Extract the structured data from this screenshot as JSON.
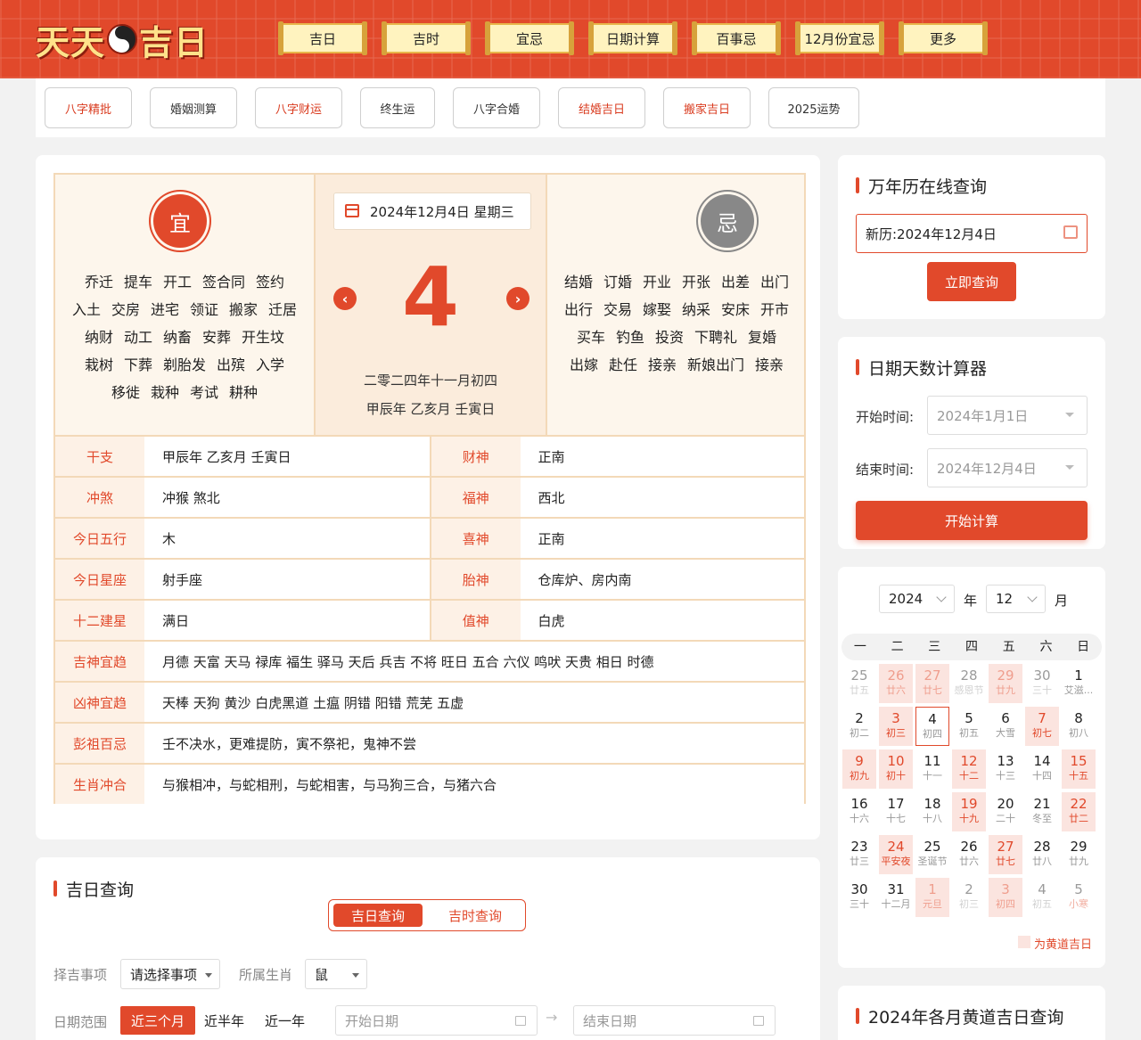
{
  "logo": {
    "part1": "天天",
    "part2": "吉日"
  },
  "nav": [
    "吉日",
    "吉时",
    "宜忌",
    "日期计算",
    "百事忌",
    "12月份宜忌",
    "更多"
  ],
  "tags": [
    {
      "label": "八字精批",
      "red": true
    },
    {
      "label": "婚姻测算",
      "red": false
    },
    {
      "label": "八字财运",
      "red": true
    },
    {
      "label": "终生运",
      "red": false
    },
    {
      "label": "八字合婚",
      "red": false
    },
    {
      "label": "结婚吉日",
      "red": true
    },
    {
      "label": "搬家吉日",
      "red": true
    },
    {
      "label": "2025运势",
      "red": false
    }
  ],
  "almanac": {
    "yi_badge": "宜",
    "ji_badge": "忌",
    "yi": [
      "乔迁",
      "提车",
      "开工",
      "签合同",
      "签约",
      "入土",
      "交房",
      "进宅",
      "领证",
      "搬家",
      "迁居",
      "纳财",
      "动工",
      "纳畜",
      "安葬",
      "开生坟",
      "栽树",
      "下葬",
      "剃胎发",
      "出殡",
      "入学",
      "移徙",
      "栽种",
      "考试",
      "耕种"
    ],
    "ji": [
      "结婚",
      "订婚",
      "开业",
      "开张",
      "出差",
      "出门",
      "出行",
      "交易",
      "嫁娶",
      "纳采",
      "安床",
      "开市",
      "买车",
      "钓鱼",
      "投资",
      "下聘礼",
      "复婚",
      "出嫁",
      "赴任",
      "接亲",
      "新娘出门",
      "接亲"
    ],
    "date_pill": "2024年12月4日 星期三",
    "day_number": "4",
    "prev": "‹",
    "next": "›",
    "lunar_line1": "二零二四年十一月初四",
    "lunar_line2": "甲辰年 乙亥月 壬寅日",
    "pairs": [
      [
        {
          "label": "干支",
          "value": "甲辰年 乙亥月 壬寅日"
        },
        {
          "label": "财神",
          "value": "正南"
        }
      ],
      [
        {
          "label": "冲煞",
          "value": "冲猴 煞北"
        },
        {
          "label": "福神",
          "value": "西北"
        }
      ],
      [
        {
          "label": "今日五行",
          "value": "木"
        },
        {
          "label": "喜神",
          "value": "正南"
        }
      ],
      [
        {
          "label": "今日星座",
          "value": "射手座"
        },
        {
          "label": "胎神",
          "value": "仓库炉、房内南"
        }
      ],
      [
        {
          "label": "十二建星",
          "value": "满日"
        },
        {
          "label": "值神",
          "value": "白虎"
        }
      ]
    ],
    "wide": [
      {
        "label": "吉神宜趋",
        "value": "月德 天富 天马 禄库 福生 驿马 天后 兵吉 不将 旺日 五合 六仪 鸣吠 天贵 相日 时德"
      },
      {
        "label": "凶神宜趋",
        "value": "天棒 天狗 黄沙 白虎黑道 土瘟 阴错 阳错 荒芜 五虚"
      },
      {
        "label": "彭祖百忌",
        "value": "壬不决水，更难提防，寅不祭祀，鬼神不尝"
      },
      {
        "label": "生肖冲合",
        "value": "与猴相冲，与蛇相刑，与蛇相害，与马狗三合，与猪六合"
      }
    ]
  },
  "sidebar": {
    "query_title": "万年历在线查询",
    "query_value": "新历:2024年12月4日",
    "query_button": "立即查询",
    "calc_title": "日期天数计算器",
    "start_label": "开始时间:",
    "start_value": "2024年1月1日",
    "end_label": "结束时间:",
    "end_value": "2024年12月4日",
    "calc_button": "开始计算",
    "year_value": "2024",
    "year_unit": "年",
    "month_value": "12",
    "month_unit": "月",
    "weekdays": [
      "一",
      "二",
      "三",
      "四",
      "五",
      "六",
      "日"
    ],
    "legend": "为黄道吉日",
    "monthly_title": "2024年各月黄道吉日查询"
  },
  "calendar": [
    [
      {
        "d": "25",
        "l": "廿五",
        "t": "other"
      },
      {
        "d": "26",
        "l": "廿六",
        "t": "other good"
      },
      {
        "d": "27",
        "l": "廿七",
        "t": "other good"
      },
      {
        "d": "28",
        "l": "感恩节",
        "t": "other"
      },
      {
        "d": "29",
        "l": "廿九",
        "t": "other good"
      },
      {
        "d": "30",
        "l": "三十",
        "t": "other"
      },
      {
        "d": "1",
        "l": "艾滋...",
        "t": ""
      }
    ],
    [
      {
        "d": "2",
        "l": "初二",
        "t": ""
      },
      {
        "d": "3",
        "l": "初三",
        "t": "good"
      },
      {
        "d": "4",
        "l": "初四",
        "t": "sel"
      },
      {
        "d": "5",
        "l": "初五",
        "t": ""
      },
      {
        "d": "6",
        "l": "大雪",
        "t": ""
      },
      {
        "d": "7",
        "l": "初七",
        "t": "good"
      },
      {
        "d": "8",
        "l": "初八",
        "t": ""
      }
    ],
    [
      {
        "d": "9",
        "l": "初九",
        "t": "good"
      },
      {
        "d": "10",
        "l": "初十",
        "t": "good"
      },
      {
        "d": "11",
        "l": "十一",
        "t": ""
      },
      {
        "d": "12",
        "l": "十二",
        "t": "good"
      },
      {
        "d": "13",
        "l": "十三",
        "t": ""
      },
      {
        "d": "14",
        "l": "十四",
        "t": ""
      },
      {
        "d": "15",
        "l": "十五",
        "t": "good"
      }
    ],
    [
      {
        "d": "16",
        "l": "十六",
        "t": ""
      },
      {
        "d": "17",
        "l": "十七",
        "t": ""
      },
      {
        "d": "18",
        "l": "十八",
        "t": ""
      },
      {
        "d": "19",
        "l": "十九",
        "t": "good"
      },
      {
        "d": "20",
        "l": "二十",
        "t": ""
      },
      {
        "d": "21",
        "l": "冬至",
        "t": ""
      },
      {
        "d": "22",
        "l": "廿二",
        "t": "good"
      }
    ],
    [
      {
        "d": "23",
        "l": "廿三",
        "t": ""
      },
      {
        "d": "24",
        "l": "平安夜",
        "t": "good"
      },
      {
        "d": "25",
        "l": "圣诞节",
        "t": ""
      },
      {
        "d": "26",
        "l": "廿六",
        "t": ""
      },
      {
        "d": "27",
        "l": "廿七",
        "t": "good"
      },
      {
        "d": "28",
        "l": "廿八",
        "t": ""
      },
      {
        "d": "29",
        "l": "廿九",
        "t": ""
      }
    ],
    [
      {
        "d": "30",
        "l": "三十",
        "t": ""
      },
      {
        "d": "31",
        "l": "十二月",
        "t": ""
      },
      {
        "d": "1",
        "l": "元旦",
        "t": "other good"
      },
      {
        "d": "2",
        "l": "初三",
        "t": "other"
      },
      {
        "d": "3",
        "l": "初四",
        "t": "other good"
      },
      {
        "d": "4",
        "l": "初五",
        "t": "other"
      },
      {
        "d": "5",
        "l": "小寒",
        "t": "other fest"
      }
    ]
  ],
  "jiri": {
    "title": "吉日查询",
    "tab_on": "吉日查询",
    "tab_off": "吉时查询",
    "event_label": "择吉事项",
    "event_value": "请选择事项",
    "zodiac_label": "所属生肖",
    "zodiac_value": "鼠",
    "range_label": "日期范围",
    "range_on": "近三个月",
    "range_half": "近半年",
    "range_year": "近一年",
    "start_ph": "开始日期",
    "end_ph": "结束日期",
    "arrow": "→"
  }
}
